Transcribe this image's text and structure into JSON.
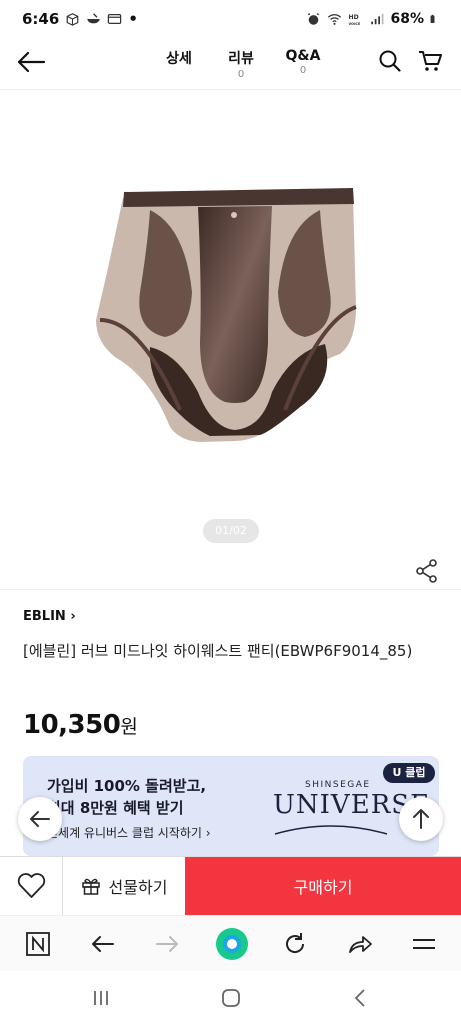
{
  "status": {
    "time": "6:46",
    "dot": "•",
    "battery": "68%"
  },
  "header": {
    "tabs": [
      {
        "label": "상세",
        "count": ""
      },
      {
        "label": "리뷰",
        "count": "0"
      },
      {
        "label": "Q&A",
        "count": "0"
      }
    ]
  },
  "gallery": {
    "pager": "01/02"
  },
  "product": {
    "brand": "EBLIN",
    "title": "[에블린] 러브 미드나잇 하이웨스트 팬티(EBWP6F9014_85)",
    "price": "10,350",
    "currency": "원"
  },
  "banner": {
    "line1": "가입비 100% 돌려받고,",
    "line2": "최대 8만원 혜택 받기",
    "line3": "신세계 유니버스 클럽 시작하기",
    "badge": "U 클럽",
    "logo_top": "SHINSEGAE",
    "logo": "UNIVERSE"
  },
  "actions": {
    "gift": "선물하기",
    "buy": "구매하기"
  },
  "colors": {
    "buy": "#f2353e",
    "banner_bg": "#dfe6f8",
    "brand_navy": "#1c2340",
    "browser_home": "#18c98b"
  },
  "icons": [
    "back-arrow-icon",
    "search-icon",
    "cart-icon",
    "share-icon",
    "heart-icon",
    "gift-icon",
    "arrow-up-icon"
  ]
}
